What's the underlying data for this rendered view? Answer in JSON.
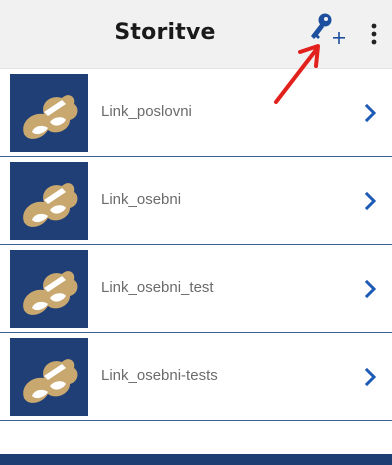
{
  "header": {
    "title": "Storitve",
    "add_key_icon": "key-plus-icon",
    "menu_icon": "more-vert-icon"
  },
  "services": [
    {
      "label": "Link_poslovni"
    },
    {
      "label": "Link_osebni"
    },
    {
      "label": "Link_osebni_test"
    },
    {
      "label": "Link_osebni-tests"
    }
  ],
  "colors": {
    "header_bg": "#f1f1f1",
    "key_blue": "#1d4f9e",
    "logo_bg": "#1f3f76",
    "logo_gold": "#c9a870",
    "chevron_blue": "#1d5ab5",
    "divider": "#3b5f93",
    "annotation_arrow": "#e2201c",
    "bottom_bar": "#1d3e73"
  }
}
